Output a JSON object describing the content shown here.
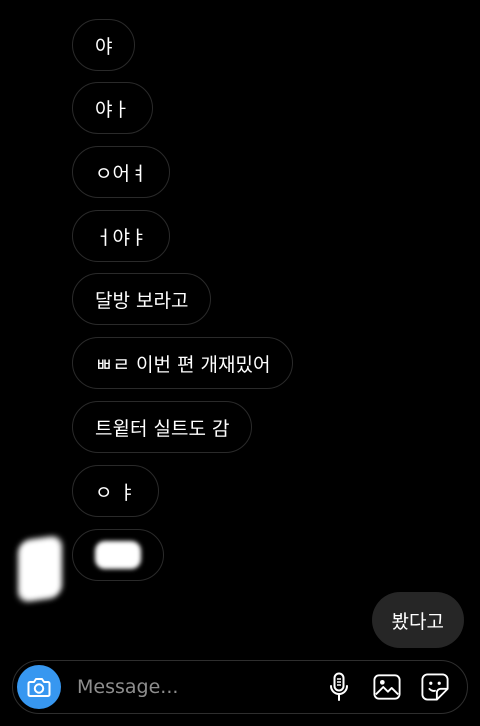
{
  "thread": {
    "incoming": [
      {
        "text": "야"
      },
      {
        "text": "야ㅏ"
      },
      {
        "text": "ㅇ어ㅕ"
      },
      {
        "text": "ㅓ야ㅑ"
      },
      {
        "text": "달방 보라고"
      },
      {
        "text": "ㅃㄹ 이번 편 개재밌어"
      },
      {
        "text": "트윝터 실트도 감"
      },
      {
        "text": "ㅇ ㅑ"
      }
    ],
    "outgoing": [
      {
        "text": "봤다고"
      }
    ]
  },
  "composer": {
    "placeholder": "Message...",
    "icons": {
      "camera": "camera-icon",
      "mic": "microphone-icon",
      "gallery": "image-icon",
      "sticker": "sticker-icon"
    }
  },
  "colors": {
    "background": "#000000",
    "accent": "#3797f0",
    "outgoing_bubble": "#262626",
    "incoming_border": "#2a2a2a",
    "placeholder": "#8e8e8e"
  }
}
